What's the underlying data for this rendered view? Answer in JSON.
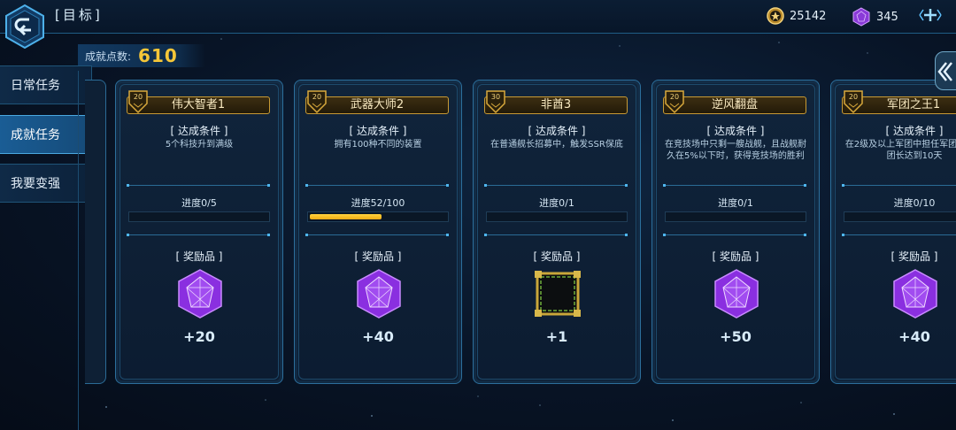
{
  "header": {
    "title": "[目标]",
    "coins": "25142",
    "gems": "345",
    "coin_icon": "gold-coin-icon",
    "gem_icon": "purple-crystal-icon"
  },
  "points": {
    "label": "成就点数:",
    "value": "610"
  },
  "tabs": [
    {
      "label": "日常任务",
      "active": false
    },
    {
      "label": "成就任务",
      "active": true
    },
    {
      "label": "我要变强",
      "active": false
    }
  ],
  "cards": [
    {
      "badge": "20",
      "title": "伟大智者1",
      "cond_label": "[ 达成条件 ]",
      "cond": "5个科技升到满级",
      "progress_text": "进度0/5",
      "progress": 0,
      "reward_label": "[ 奖励品 ]",
      "reward_icon": "purple-crystal-icon",
      "reward": "+20"
    },
    {
      "badge": "20",
      "title": "武器大师2",
      "cond_label": "[ 达成条件 ]",
      "cond": "拥有100种不同的装置",
      "progress_text": "进度52/100",
      "progress": 0.52,
      "reward_label": "[ 奖励品 ]",
      "reward_icon": "purple-crystal-icon",
      "reward": "+40"
    },
    {
      "badge": "30",
      "title": "非酋3",
      "cond_label": "[ 达成条件 ]",
      "cond": "在普通舰长招募中，触发SSR保底",
      "progress_text": "进度0/1",
      "progress": 0,
      "reward_label": "[ 奖励品 ]",
      "reward_icon": "gold-frame-icon",
      "reward": "+1"
    },
    {
      "badge": "20",
      "title": "逆风翻盘",
      "cond_label": "[ 达成条件 ]",
      "cond": "在竞技场中只剩一艘战舰，且战舰耐久在5%以下时，获得竞技场的胜利",
      "progress_text": "进度0/1",
      "progress": 0,
      "reward_label": "[ 奖励品 ]",
      "reward_icon": "purple-crystal-icon",
      "reward": "+50"
    },
    {
      "badge": "20",
      "title": "军团之王1",
      "cond_label": "[ 达成条件 ]",
      "cond": "在2级及以上军团中担任军团长或副团长达到10天",
      "progress_text": "进度0/10",
      "progress": 0,
      "reward_label": "[ 奖励品 ]",
      "reward_icon": "purple-crystal-icon",
      "reward": "+40"
    }
  ]
}
